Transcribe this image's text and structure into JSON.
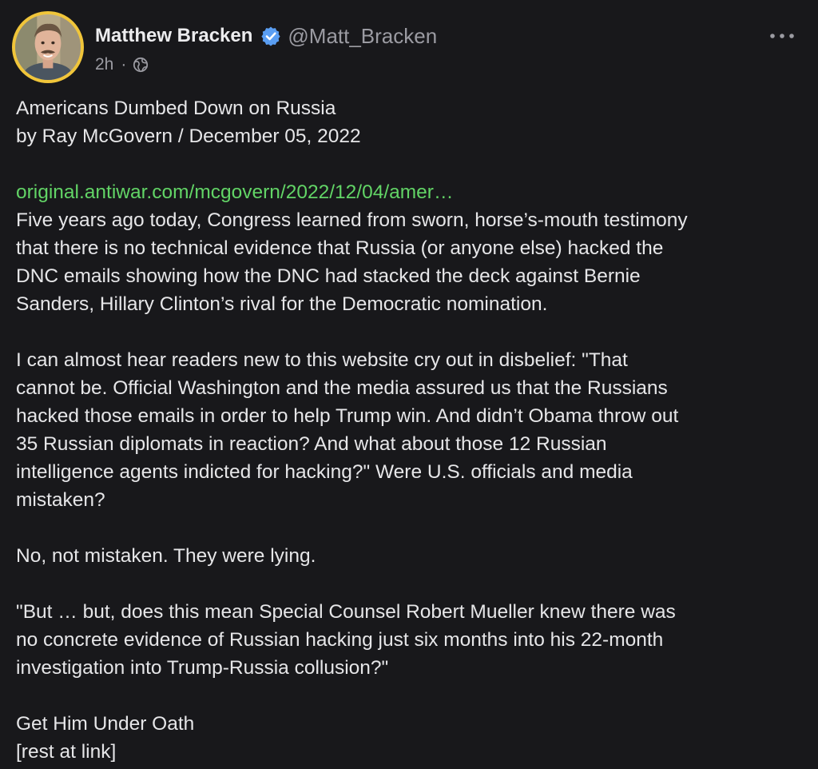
{
  "author": {
    "display_name": "Matthew Bracken",
    "handle": "@Matt_Bracken",
    "time": "2h",
    "separator": "·",
    "avatar_icon": "user-avatar",
    "verified_icon": "verified-badge-icon",
    "visibility_icon": "globe-icon"
  },
  "colors": {
    "background": "#18181b",
    "link": "#62d466",
    "verified": "#5a9ef3",
    "avatar_border": "#f0c53a",
    "secondary_text": "#9b9ba2"
  },
  "menu": {
    "icon": "more-horizontal-icon"
  },
  "post": {
    "title_lines": [
      "Americans Dumbed Down on Russia",
      "by Ray McGovern / December 05, 2022"
    ],
    "link_text": "original.antiwar.com/mcgovern/2022/12/04/amer…",
    "para1": [
      "Five years ago today, Congress learned from sworn, horse’s-mouth testimony",
      "that there is no technical evidence that Russia (or anyone else) hacked the",
      "DNC emails showing how the DNC had stacked the deck against Bernie",
      "Sanders, Hillary Clinton’s rival for the Democratic nomination."
    ],
    "para2": [
      "I can almost hear readers new to this website cry out in disbelief: \"That",
      "cannot be. Official Washington and the media assured us that the Russians",
      "hacked those emails in order to help Trump win. And didn’t Obama throw out",
      "35 Russian diplomats in reaction? And what about those 12 Russian",
      "intelligence agents indicted for hacking?\" Were U.S. officials and media",
      "mistaken?"
    ],
    "para3": [
      "No, not mistaken. They were lying."
    ],
    "para4": [
      "\"But … but, does this mean Special Counsel Robert Mueller knew there was",
      "no concrete evidence of Russian hacking just six months into his 22-month",
      "investigation into Trump-Russia collusion?\""
    ],
    "para5": [
      "Get Him Under Oath",
      "[rest at link]"
    ]
  }
}
